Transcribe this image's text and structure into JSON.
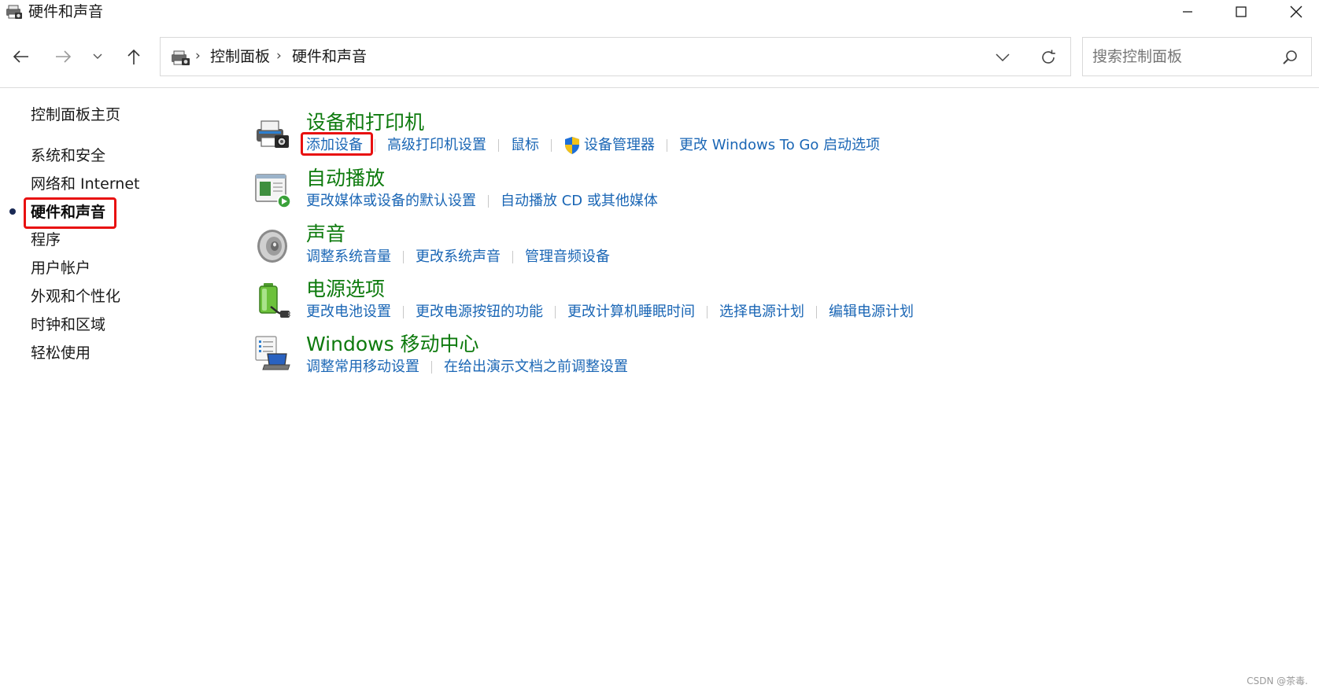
{
  "window": {
    "title": "硬件和声音"
  },
  "address": {
    "crumbs": [
      "控制面板",
      "硬件和声音"
    ]
  },
  "search": {
    "placeholder": "搜索控制面板"
  },
  "sidebar": {
    "items": [
      {
        "label": "控制面板主页"
      },
      {
        "label": "系统和安全"
      },
      {
        "label": "网络和 Internet"
      },
      {
        "label": "硬件和声音",
        "active": true
      },
      {
        "label": "程序"
      },
      {
        "label": "用户帐户"
      },
      {
        "label": "外观和个性化"
      },
      {
        "label": "时钟和区域"
      },
      {
        "label": "轻松使用"
      }
    ]
  },
  "categories": [
    {
      "title": "设备和打印机",
      "icon": "printer-icon",
      "links": [
        "添加设备",
        "高级打印机设置",
        "鼠标",
        "设备管理器",
        "更改 Windows To Go 启动选项"
      ]
    },
    {
      "title": "自动播放",
      "icon": "autoplay-icon",
      "links": [
        "更改媒体或设备的默认设置",
        "自动播放 CD 或其他媒体"
      ]
    },
    {
      "title": "声音",
      "icon": "speaker-icon",
      "links": [
        "调整系统音量",
        "更改系统声音",
        "管理音频设备"
      ]
    },
    {
      "title": "电源选项",
      "icon": "battery-icon",
      "links": [
        "更改电池设置",
        "更改电源按钮的功能",
        "更改计算机睡眠时间",
        "选择电源计划",
        "编辑电源计划"
      ]
    },
    {
      "title": "Windows 移动中心",
      "icon": "mobility-center-icon",
      "links": [
        "调整常用移动设置",
        "在给出演示文档之前调整设置"
      ]
    }
  ],
  "colors": {
    "category_title": "#0d7a0d",
    "link": "#1a66b5",
    "highlight_box": "#e81010"
  },
  "watermark": "CSDN @茶毒."
}
